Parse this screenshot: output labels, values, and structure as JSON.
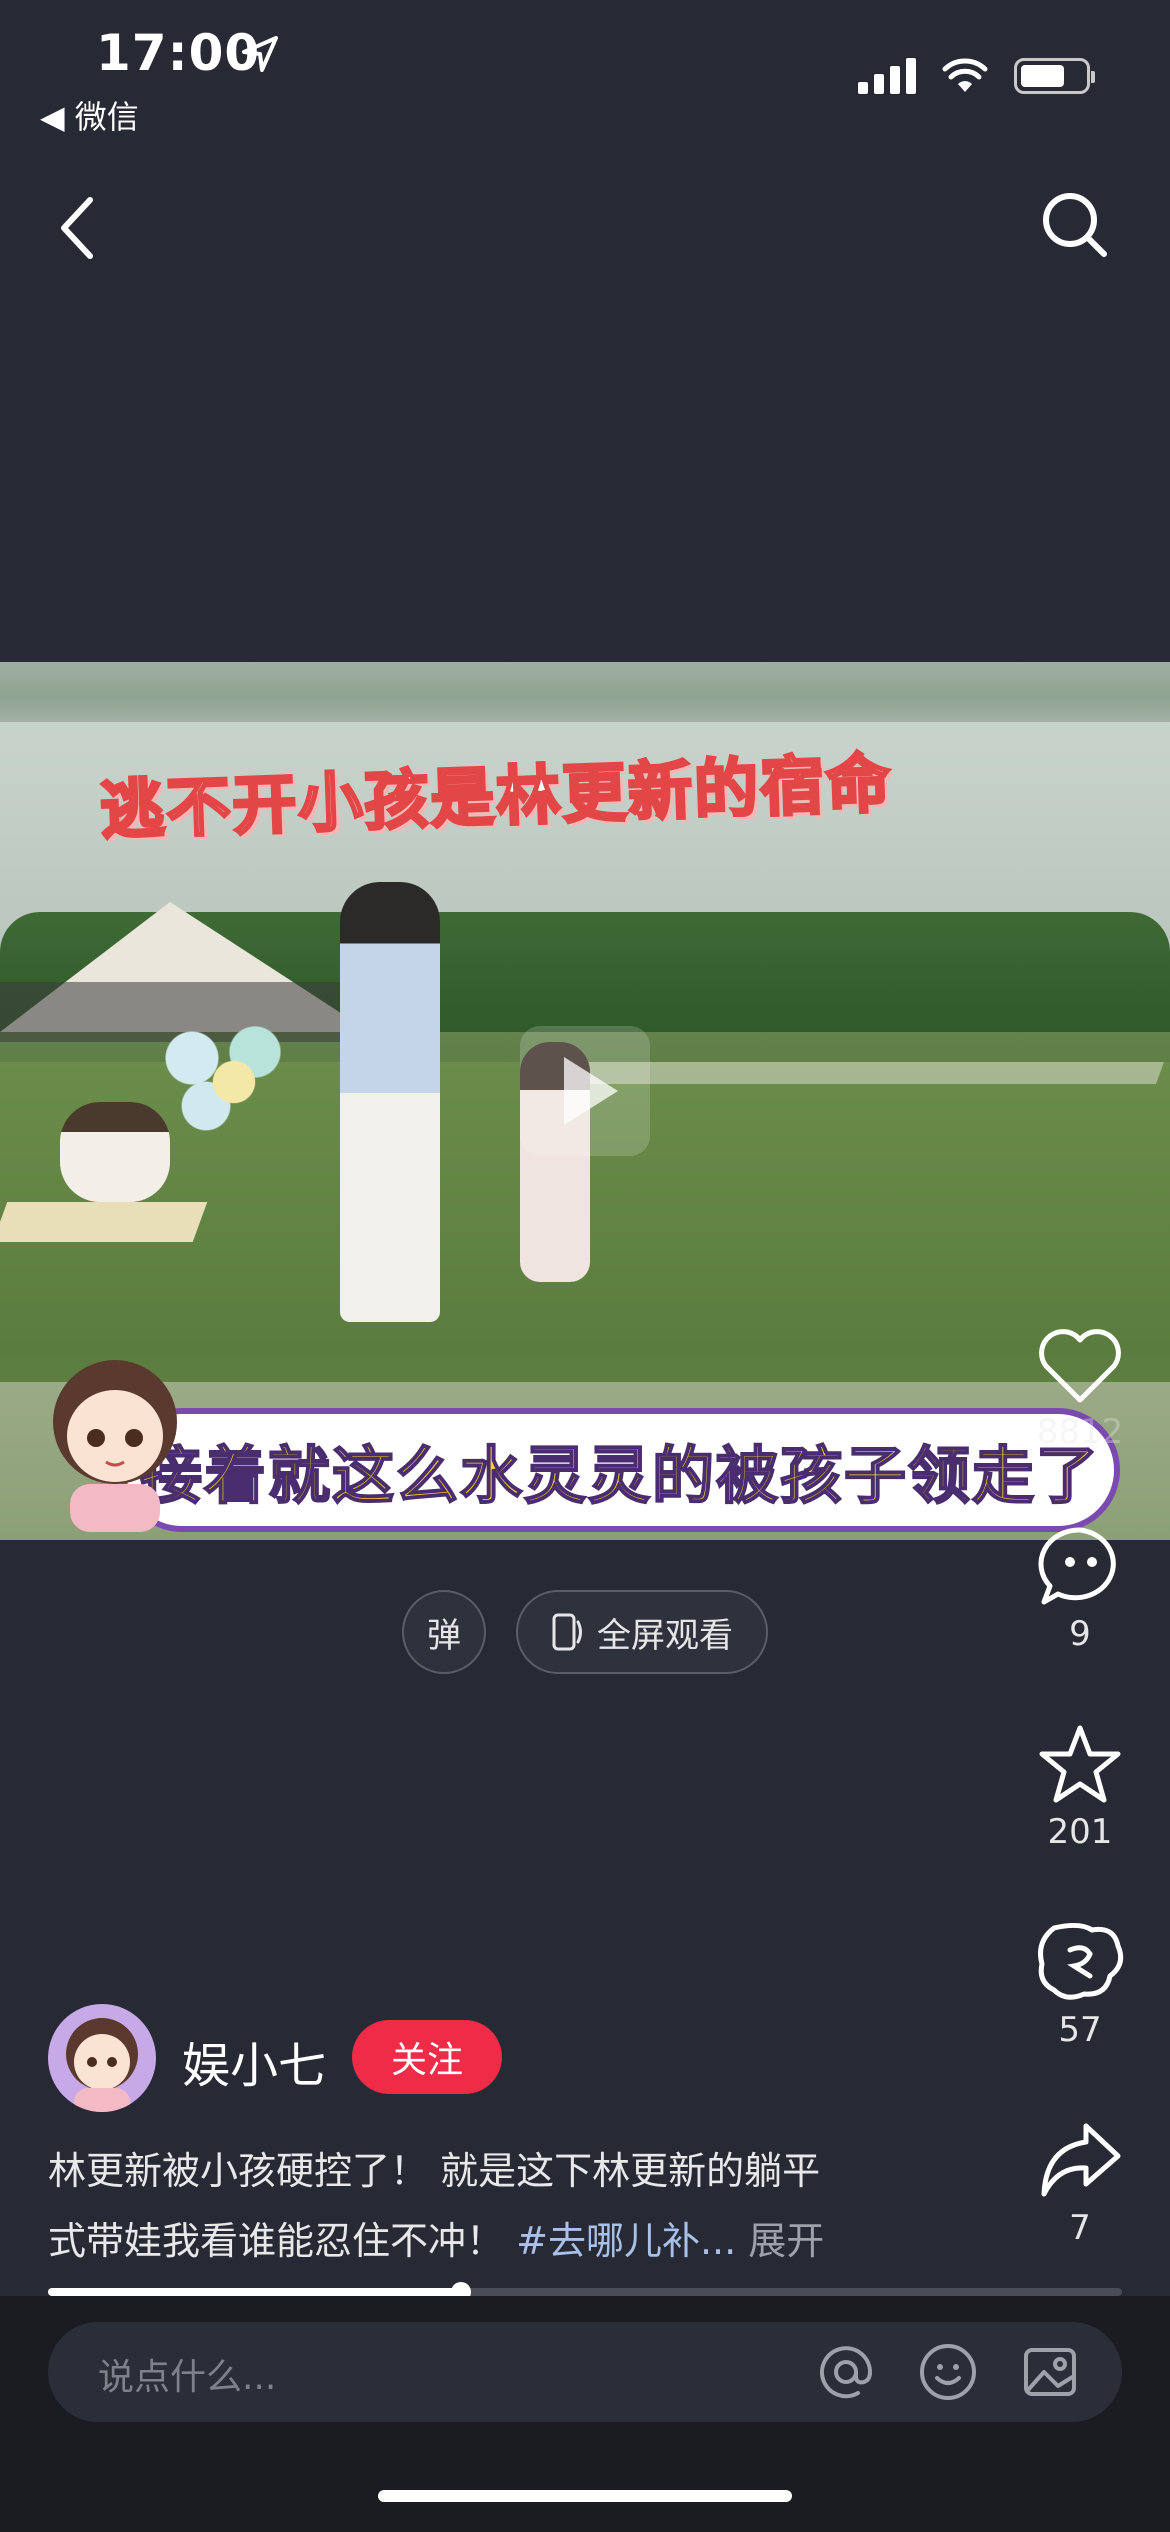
{
  "status_bar": {
    "time": "17:00",
    "back_app": "◀ 微信",
    "icons": [
      "location-arrow-icon",
      "signal-icon",
      "wifi-icon",
      "battery-icon"
    ]
  },
  "nav": {
    "back_icon": "chevron-left-icon",
    "search_icon": "search-icon"
  },
  "video": {
    "top_caption": "逃不开小孩是林更新的宿命",
    "bottom_caption": "接着就这么水灵灵的被孩子领走了",
    "play_icon": "play-icon"
  },
  "controls": {
    "danmu_label": "弹",
    "fullscreen_label": "全屏观看"
  },
  "rail": {
    "like_count": "8812",
    "comment_count": "9",
    "favorite_count": "201",
    "share_wechat_count": "57",
    "share_count": "7"
  },
  "author": {
    "name": "娱小七",
    "follow_label": "关注"
  },
  "description": {
    "line1": "林更新被小孩硬控了！ 就是这下林更新的躺平",
    "line2": "式带娃我看谁能忍住不冲！",
    "tag": "#去哪儿补...",
    "more": "展开"
  },
  "progress": {
    "played_fraction": 0.385
  },
  "comment_bar": {
    "placeholder": "说点什么...",
    "icons": [
      "at-icon",
      "emoji-icon",
      "image-icon"
    ]
  },
  "colors": {
    "background": "#272a35",
    "follow_button": "#ef2b48",
    "hashtag": "#a9c1e8"
  }
}
